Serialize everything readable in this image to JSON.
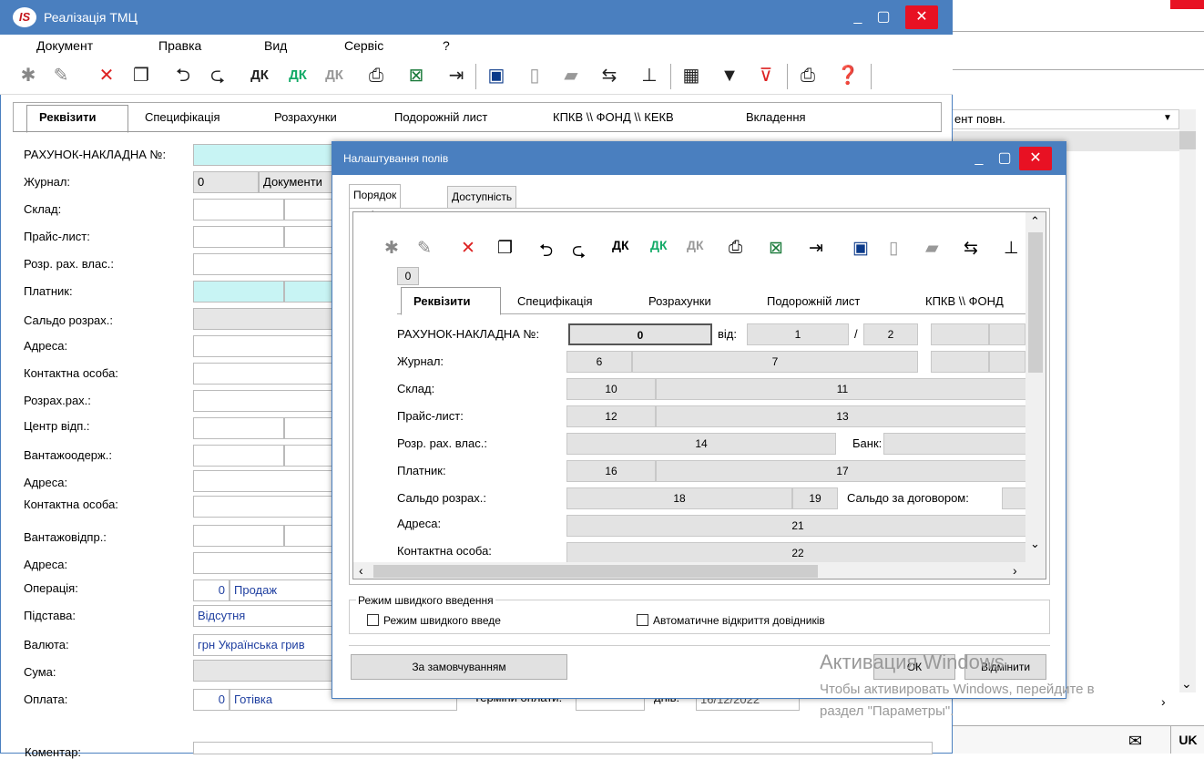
{
  "main_window": {
    "title": "Реалізація ТМЦ",
    "logo": "IS",
    "menu": [
      "Документ",
      "Правка",
      "Вид",
      "Сервіс",
      "?"
    ],
    "tabs": [
      "Реквізити",
      "Специфікація",
      "Розрахунки",
      "Подорожній лист",
      "КПКВ \\\\ ФОНД \\\\ КЕКВ",
      "Вкладення"
    ],
    "fields": {
      "invoice_label": "РАХУНОК-НАКЛАДНА №:",
      "journal_label": "Журнал:",
      "journal_value": "0",
      "journal_type": "Документи",
      "warehouse_label": "Склад:",
      "pricelist_label": "Прайс-лист:",
      "own_account_label": "Розр. рах. влас.:",
      "payer_label": "Платник:",
      "balance_label": "Сальдо розрах.:",
      "address_label": "Адреса:",
      "contact_label": "Контактна особа:",
      "account_label": "Розрах.рах.:",
      "center_label": "Центр відп.:",
      "consignee_label": "Вантажоодерж.:",
      "address2_label": "Адреса:",
      "contact2_label": "Контактна особа:",
      "shipper_label": "Вантажовідпр.:",
      "address3_label": "Адреса:",
      "operation_label": "Операція:",
      "operation_code": "0",
      "operation_value": "Продаж",
      "basis_label": "Підстава:",
      "basis_value": "Відсутня",
      "currency_label": "Валюта:",
      "currency_value": "грн Українська грив",
      "sum_label": "Сума:",
      "payment_label": "Оплата:",
      "payment_code": "0",
      "payment_value": "Готівка",
      "terms_label": "Терміни оплати:",
      "days_label": "днів:",
      "date_value": "16/12/2022",
      "comment_label": "Коментар:"
    }
  },
  "background_window": {
    "column_header": "ент повн."
  },
  "dialog": {
    "title": "Налаштування полів",
    "tabs": [
      "Порядок полів",
      "Доступність полів"
    ],
    "preview": {
      "corner_number": "0",
      "tabs": [
        "Реквізити",
        "Специфікація",
        "Розрахунки",
        "Подорожній лист",
        "КПКВ \\\\ ФОНД"
      ],
      "labels": {
        "invoice": "РАХУНОК-НАКЛАДНА №:",
        "from": "від:",
        "slash": "/",
        "journal": "Журнал:",
        "warehouse": "Склад:",
        "pricelist": "Прайс-лист:",
        "own_account": "Розр. рах. влас.:",
        "bank": "Банк:",
        "payer": "Платник:",
        "balance": "Сальдо розрах.:",
        "contract_balance": "Сальдо за договором:",
        "address": "Адреса:",
        "contact": "Контактна особа:"
      },
      "numbers": [
        "0",
        "1",
        "2",
        "6",
        "7",
        "10",
        "11",
        "12",
        "13",
        "14",
        "16",
        "17",
        "18",
        "19",
        "21",
        "22"
      ]
    },
    "group_label": "Режим швидкого введення",
    "quick_entry": "Режим швидкого введе",
    "auto_open": "Автоматичне відкриття довідників",
    "default_button": "За замовчуванням",
    "ok_button": "ОК",
    "cancel_button": "Відмінити"
  },
  "watermark": {
    "line1": "Активация Windows",
    "line2": "Чтобы активировать Windows, перейдите в",
    "line3": "раздел \"Параметры\"."
  },
  "status": {
    "lang": "UK"
  },
  "colors": {
    "titlebar": "#4a7fbf",
    "close": "#e81123",
    "highlight": "#c8f4f4",
    "link": "#1f3fa0"
  }
}
